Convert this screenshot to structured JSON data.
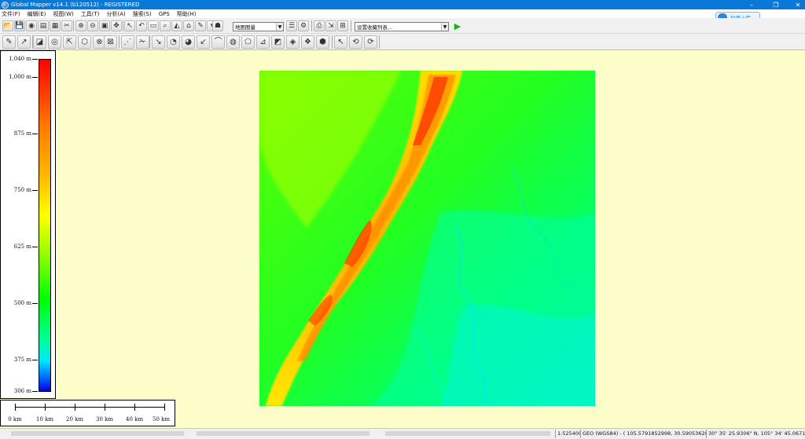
{
  "window": {
    "title": "Global Mapper v14.1 (b120512) - REGISTERED",
    "minimize_glyph": "–",
    "maximize_glyph": "❐",
    "close_glyph": "✕"
  },
  "menu": [
    "文件(F)",
    "编辑(E)",
    "视图(W)",
    "工具(T)",
    "分析(A)",
    "搜索(S)",
    "GPS",
    "帮助(H)"
  ],
  "toolbar": {
    "layer_combo": "地图图量",
    "bookmark_combo": "设置收藏列表...",
    "combo_arrow": "▼",
    "play_glyph": "▶",
    "upload_label": "拍摄上传"
  },
  "legend": {
    "labels": [
      "1,040 m",
      "1,000 m",
      "875 m",
      "750 m",
      "625 m",
      "500 m",
      "375 m",
      "306 m"
    ],
    "colors": {
      "high": "#ff0000",
      "mid": "#00ff00",
      "low": "#0000e0"
    }
  },
  "scale_bar": {
    "labels": [
      "0 km",
      "10 km",
      "20 km",
      "30 km",
      "40 km",
      "50 km"
    ]
  },
  "map": {
    "background": "#fdfdc9"
  },
  "status_bar": {
    "scale": "1:525400",
    "coords": "GEO (WGS84) - ( 105.5791852998, 30.5905362875 )",
    "dms": "30° 35' 25.9306\" N, 105° 34' 45.0671\" E"
  }
}
